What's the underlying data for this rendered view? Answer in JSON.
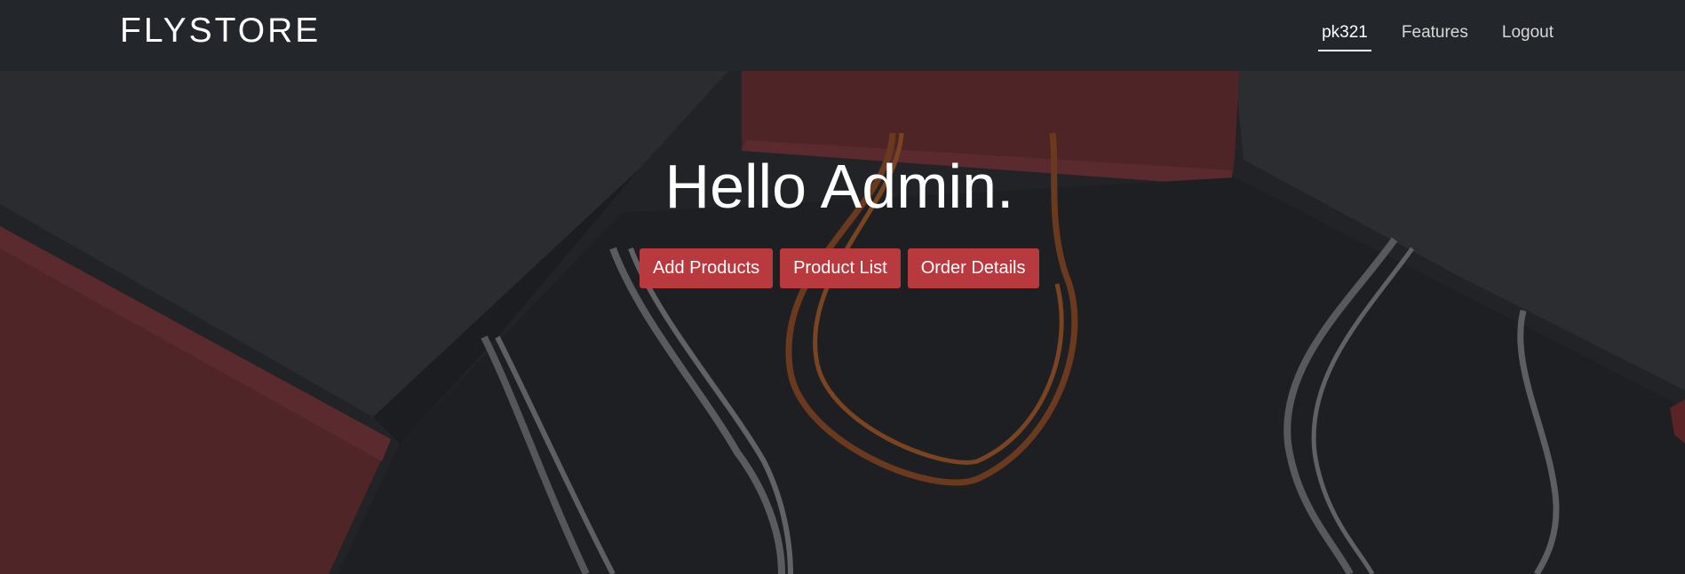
{
  "navbar": {
    "brand": "FLYSTORE",
    "links": [
      {
        "label": "pk321",
        "active": true
      },
      {
        "label": "Features",
        "active": false
      },
      {
        "label": "Logout",
        "active": false
      }
    ]
  },
  "hero": {
    "title": "Hello Admin.",
    "buttons": [
      {
        "label": "Add Products"
      },
      {
        "label": "Product List"
      },
      {
        "label": "Order Details"
      }
    ]
  },
  "colors": {
    "navbar_bg": "#23262b",
    "hero_bg": "#212327",
    "button_bg": "#b8393e",
    "bag_red": "#5a2326",
    "handle_gray": "#6e6e72",
    "handle_orange": "#8a4a22"
  }
}
